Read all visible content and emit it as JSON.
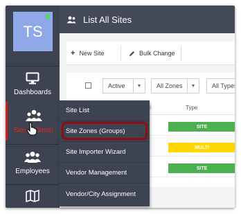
{
  "user": {
    "initials": "TS"
  },
  "sidebar": {
    "items": [
      {
        "label": "Dashboards",
        "icon": "monitor-icon"
      },
      {
        "label": "Sites (Client)",
        "icon": "people-network-icon",
        "active": true
      },
      {
        "label": "Employees",
        "icon": "employees-icon"
      },
      {
        "label": "",
        "icon": "map-icon"
      }
    ]
  },
  "header": {
    "title": "List All Sites",
    "icon": "users-icon"
  },
  "toolbar": {
    "new_site": "New Site",
    "bulk_change": "Bulk Change"
  },
  "filters": {
    "status": "Active",
    "zones": "All Zones",
    "types": "All Types"
  },
  "table": {
    "header_type": "Type",
    "header_hash": "#",
    "rows": [
      {
        "type": "SITE"
      },
      {
        "type": "MULTI"
      },
      {
        "type": "SITE"
      }
    ]
  },
  "menu": {
    "items": [
      "Site List",
      "Site Zones (Groups)",
      "Site Importer Wizard",
      "Vendor Management",
      "Vendor/City Assignment"
    ],
    "highlighted_index": 1
  },
  "colors": {
    "sidebar": "#3d4350",
    "header": "#434957",
    "active_accent": "#d41e1e",
    "avatar": "#8ea8e8",
    "site_badge": "#4caf50",
    "multi_badge": "#ffd600",
    "highlight_ring": "#8b0f14"
  }
}
